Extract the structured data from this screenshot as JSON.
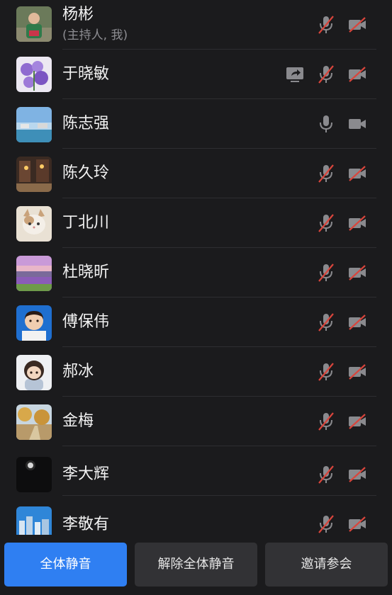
{
  "participants": [
    {
      "name": "杨彬",
      "sub": "(主持人, 我)",
      "mic": "muted",
      "camera": "off",
      "share": false,
      "avatar_icon": "child-photo-avatar"
    },
    {
      "name": "于晓敏",
      "mic": "muted",
      "camera": "off",
      "share": true,
      "avatar_icon": "purple-flowers-avatar"
    },
    {
      "name": "陈志强",
      "mic": "on",
      "camera": "on",
      "share": false,
      "avatar_icon": "seaside-avatar"
    },
    {
      "name": "陈久玲",
      "mic": "muted",
      "camera": "off",
      "share": false,
      "avatar_icon": "night-street-avatar"
    },
    {
      "name": "丁北川",
      "mic": "muted",
      "camera": "off",
      "share": false,
      "avatar_icon": "cat-avatar"
    },
    {
      "name": "杜晓昕",
      "mic": "muted",
      "camera": "off",
      "share": false,
      "avatar_icon": "lavender-field-avatar"
    },
    {
      "name": "傅保伟",
      "mic": "muted",
      "camera": "off",
      "share": false,
      "avatar_icon": "baby-portrait-avatar"
    },
    {
      "name": "郝冰",
      "mic": "muted",
      "camera": "off",
      "share": false,
      "avatar_icon": "cartoon-girl-avatar"
    },
    {
      "name": "金梅",
      "mic": "muted",
      "camera": "off",
      "share": false,
      "avatar_icon": "autumn-path-avatar"
    },
    {
      "name": "李大辉",
      "mic": "muted",
      "camera": "off",
      "share": false,
      "avatar_icon": "night-moon-avatar"
    },
    {
      "name": "李敬有",
      "mic": "muted",
      "camera": "off",
      "share": false,
      "avatar_icon": "city-skyline-avatar"
    }
  ],
  "actions": {
    "mute_all": "全体静音",
    "unmute_all": "解除全体静音",
    "invite": "邀请参会"
  },
  "colors": {
    "background": "#1b1b1d",
    "accent": "#2f7ff2",
    "icon": "#8a8a8e",
    "muted_slash": "#d9453c",
    "secondary_button": "#323235"
  }
}
